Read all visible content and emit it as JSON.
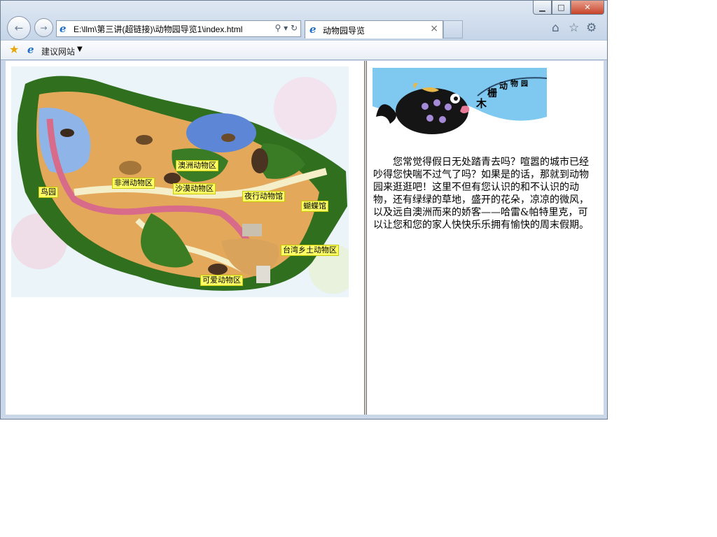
{
  "browser": {
    "address_url": "E:\\llm\\第三讲(超链接)\\动物园导览1\\index.html",
    "tab_title": "动物园导览",
    "favorites_item": "建议网站",
    "window_controls": {
      "minimize": "▁",
      "maximize": "□",
      "close": "✕"
    }
  },
  "map": {
    "labels": [
      "鸟园",
      "非洲动物区",
      "澳洲动物区",
      "沙漠动物区",
      "夜行动物馆",
      "蝴蝶馆",
      "台湾乡土动物区",
      "可爱动物区"
    ]
  },
  "banner": {
    "text": [
      "木",
      "栅",
      "动",
      "物",
      "园"
    ]
  },
  "description": "您常觉得假日无处踏青去吗？喧嚣的城市已经吵得您快喘不过气了吗？如果是的话，那就到动物园来逛逛吧！这里不但有您认识的和不认识的动物，还有绿绿的草地，盛开的花朵，凉凉的微风，以及远自澳洲而来的娇客——哈雷&帕特里克，可以让您和您的家人快快乐乐拥有愉快的周末假期。",
  "colors": {
    "label_bg": "#ffff66",
    "accent": "#1e6fc8"
  },
  "icons": [
    "back-arrow-icon",
    "forward-arrow-icon",
    "ie-page-icon",
    "search-icon",
    "refresh-icon",
    "home-icon",
    "favorites-star-icon",
    "gear-icon",
    "close-tab-icon",
    "add-favorites-icon",
    "dropdown-arrow-icon"
  ]
}
